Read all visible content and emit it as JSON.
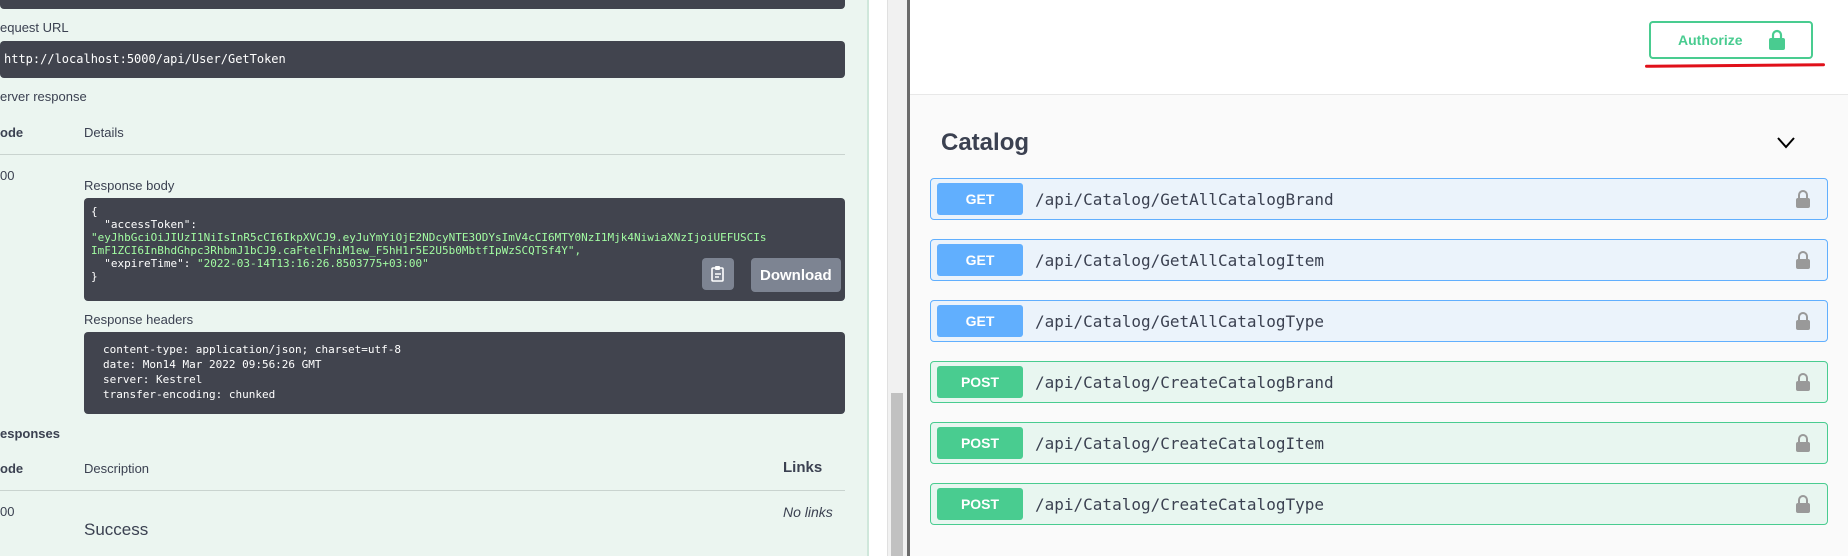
{
  "left": {
    "request_url_label": "equest URL",
    "request_url": "http://localhost:5000/api/User/GetToken",
    "server_response_label": "erver response",
    "col_code": "ode",
    "col_details": "Details",
    "status_code": "00",
    "response_body_label": "Response body",
    "body_lines": [
      "{",
      "  \"accessToken\": ",
      "\"eyJhbGciOiJIUzI1NiIsInR5cCI6IkpXVCJ9.eyJuYmYiOjE2NDcyNTE3ODYsImV4cCI6MTY0NzI1Mjk4NiwiaXNzIjoiUEFUSCIs",
      "ImF1ZCI6InBhdGhpc3RhbmJ1bCJ9.caFtelFhiM1ew_F5hH1r5E2U5b0MbtfIpWzSCQTSf4Y\",",
      "  \"expireTime\": ",
      "\"2022-03-14T13:16:26.8503775+03:00\"",
      "}"
    ],
    "download_label": "Download",
    "response_headers_label": "Response headers",
    "headers_lines": [
      "content-type: application/json; charset=utf-8",
      "date: Mon14 Mar 2022 09:56:26 GMT",
      "server: Kestrel",
      "transfer-encoding: chunked"
    ],
    "responses_label": "esponses",
    "col_code2": "ode",
    "col_description": "Description",
    "col_links": "Links",
    "resp_code": "00",
    "no_links": "No links",
    "success": "Success"
  },
  "right": {
    "authorize_label": "Authorize",
    "section_title": "Catalog",
    "operations": [
      {
        "method": "GET",
        "path": "/api/Catalog/GetAllCatalogBrand"
      },
      {
        "method": "GET",
        "path": "/api/Catalog/GetAllCatalogItem"
      },
      {
        "method": "GET",
        "path": "/api/Catalog/GetAllCatalogType"
      },
      {
        "method": "POST",
        "path": "/api/Catalog/CreateCatalogBrand"
      },
      {
        "method": "POST",
        "path": "/api/Catalog/CreateCatalogItem"
      },
      {
        "method": "POST",
        "path": "/api/Catalog/CreateCatalogType"
      }
    ]
  },
  "colors": {
    "get": "#61affe",
    "post": "#49cc90",
    "accent_red": "#e0101a"
  }
}
